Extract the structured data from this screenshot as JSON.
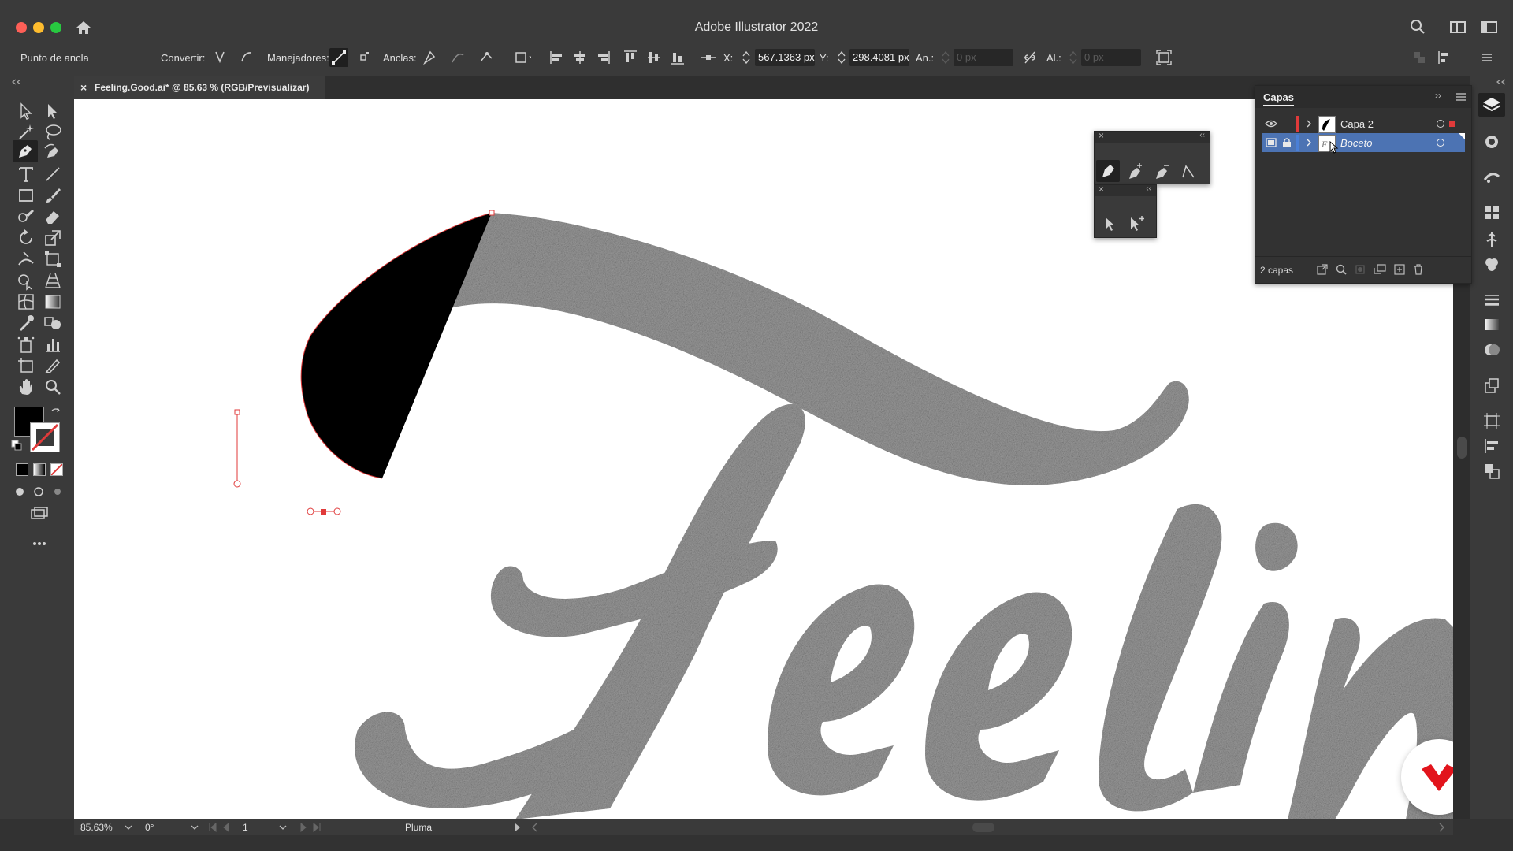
{
  "app": {
    "title": "Adobe Illustrator 2022"
  },
  "control_bar": {
    "selection_label": "Punto de ancla",
    "convert_label": "Convertir:",
    "handles_label": "Manejadores:",
    "anchors_label": "Anclas:",
    "x_label": "X:",
    "x_value": "567.1363 px",
    "y_label": "Y:",
    "y_value": "298.4081 px",
    "width_label": "An.:",
    "width_value": "0 px",
    "height_label": "Al.:",
    "height_value": "0 px"
  },
  "document_tab": {
    "close_glyph": "×",
    "title": "Feeling.Good.ai* @ 85.63 % (RGB/Previsualizar)"
  },
  "layers_panel": {
    "title": "Capas",
    "layers": [
      {
        "name": "Capa 2",
        "color": "#e03a3a",
        "selected": false
      },
      {
        "name": "Boceto",
        "color": "#4a7fd6",
        "selected": true
      }
    ],
    "footer_count": "2 capas"
  },
  "status_bar": {
    "zoom": "85.63%",
    "rotation": "0°",
    "artboard": "1",
    "tool_name": "Pluma"
  },
  "colors": {
    "accent_red": "#e03a3a",
    "sketch_gray": "#9b9b9b",
    "fill_black": "#000000",
    "brand_badge": "#e2141c"
  },
  "canvas_art": {
    "sketch_lettering": "Feelin"
  }
}
